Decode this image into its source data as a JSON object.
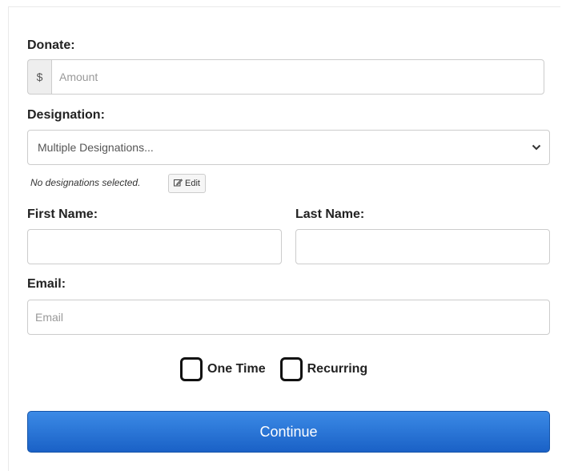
{
  "donate": {
    "label": "Donate:",
    "currency_symbol": "$",
    "amount_placeholder": "Amount"
  },
  "designation": {
    "label": "Designation:",
    "selected": "Multiple Designations...",
    "note": "No designations selected.",
    "edit_label": "Edit",
    "chevron_icon": "chevron-down-icon",
    "edit_icon": "edit-icon"
  },
  "first_name": {
    "label": "First Name:",
    "value": ""
  },
  "last_name": {
    "label": "Last Name:",
    "value": ""
  },
  "email": {
    "label": "Email:",
    "placeholder": "Email"
  },
  "frequency": {
    "options": [
      {
        "label": "One Time",
        "checked": false
      },
      {
        "label": "Recurring",
        "checked": false
      }
    ]
  },
  "continue_button": {
    "label": "Continue",
    "color_top": "#3b8ae6",
    "color_bottom": "#1a61c6"
  }
}
